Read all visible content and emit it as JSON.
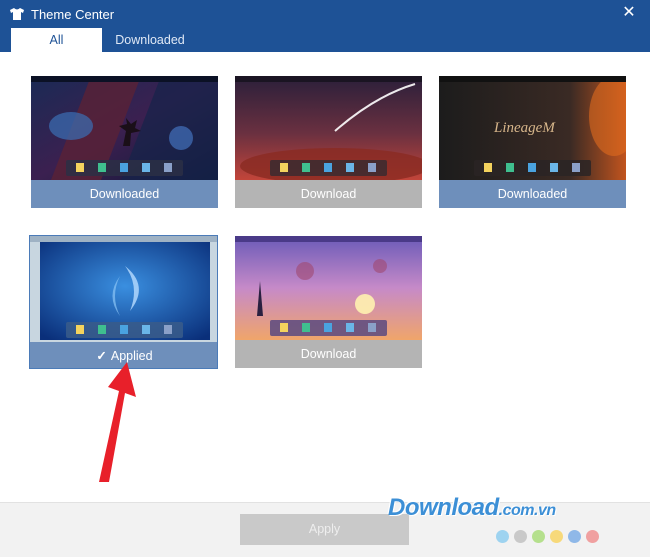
{
  "window": {
    "title": "Theme Center",
    "close_glyph": "✕",
    "app_icon": "shirt-icon"
  },
  "tabs": [
    {
      "label": "All",
      "selected": true
    },
    {
      "label": "Downloaded",
      "selected": false
    }
  ],
  "themes": [
    {
      "name": "space-tree",
      "label": "Downloaded",
      "status": "downloaded"
    },
    {
      "name": "meteor-night",
      "label": "Download",
      "status": "not-downloaded"
    },
    {
      "name": "lineage-m",
      "label": "Downloaded",
      "status": "downloaded",
      "logo_text": "LineageM"
    },
    {
      "name": "blue-feathers",
      "label": "Applied",
      "status": "applied",
      "check_icon": "checkmark-icon"
    },
    {
      "name": "sunset-sky",
      "label": "Download",
      "status": "not-downloaded"
    }
  ],
  "footer": {
    "apply_label": "Apply",
    "apply_enabled": false
  },
  "watermark": {
    "text": "Download",
    "tld": ".com.vn",
    "dot_colors": [
      "#9ed3f0",
      "#c9c9c9",
      "#b5e08d",
      "#f7d97a",
      "#8fb8e8",
      "#f0a0a0"
    ]
  },
  "annotation": {
    "arrow_color": "#e8202a",
    "icon": "red-arrow-icon"
  },
  "colors": {
    "titlebar": "#1e5296",
    "label_downloaded": "#6e8fbb",
    "label_download": "#b4b4b4"
  }
}
